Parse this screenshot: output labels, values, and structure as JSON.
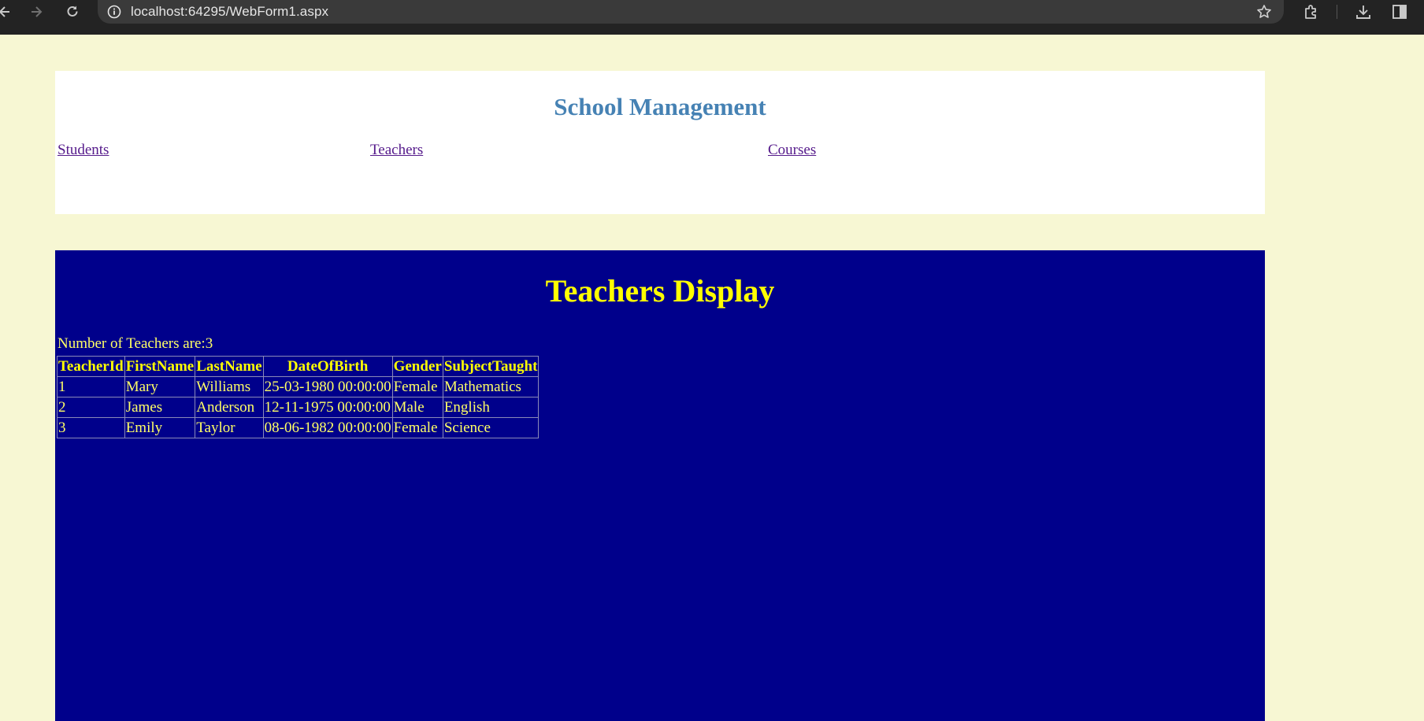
{
  "browser": {
    "url": "localhost:64295/WebForm1.aspx",
    "icons": {
      "back": "back-arrow-icon",
      "forward": "forward-arrow-icon",
      "reload": "reload-icon",
      "site_info": "site-info-icon",
      "bookmark": "star-icon",
      "extensions": "puzzle-icon",
      "downloads": "download-icon",
      "side_panel": "side-panel-icon"
    }
  },
  "header": {
    "title": "School Management",
    "nav": {
      "students": "Students",
      "teachers": "Teachers",
      "courses": "Courses"
    }
  },
  "main": {
    "heading": "Teachers Display",
    "count_text": "Number of Teachers are:3",
    "table": {
      "columns": [
        "TeacherId",
        "FirstName",
        "LastName",
        "DateOfBirth",
        "Gender",
        "SubjectTaught"
      ],
      "rows": [
        [
          "1",
          "Mary",
          "Williams",
          "25-03-1980 00:00:00",
          "Female",
          "Mathematics"
        ],
        [
          "2",
          "James",
          "Anderson",
          "12-11-1975 00:00:00",
          "Male",
          "English"
        ],
        [
          "3",
          "Emily",
          "Taylor",
          "08-06-1982 00:00:00",
          "Female",
          "Science"
        ]
      ]
    }
  },
  "colors": {
    "page_background": "#f7f7d3",
    "header_background": "#ffffff",
    "title_color": "#4682b4",
    "link_color": "#551a8b",
    "content_background": "#00008b",
    "heading_color": "#ffff00",
    "text_color": "#ffff66"
  }
}
